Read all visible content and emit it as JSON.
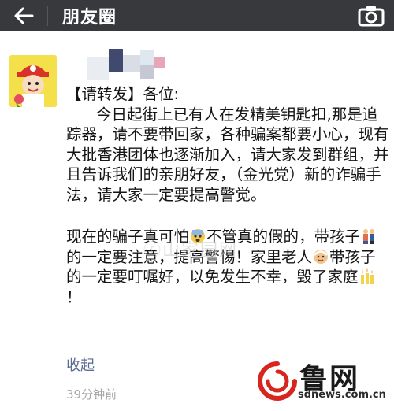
{
  "header": {
    "title": "朋友圈",
    "back_icon": "arrow-left-icon",
    "camera_icon": "camera-icon",
    "background": "#38393d"
  },
  "post": {
    "heading": "【请转发】各位:",
    "para1": "今日起街上已有人在发精美钥匙扣,那是追踪器，请不要带回家，各种骗案都要小心，现有大批香港团体也逐渐加入，请大家发到群组，并且告诉我们的亲朋好友，（金光党）新的诈骗手法，请大家一定要提高警觉。",
    "para2_a": "现在的骗子真可怕",
    "para2_b": "不管真的假的，带孩子",
    "para2_c": "的一定要注意，提高警惕！家里老人",
    "para2_d": "带孩子的一定要叮嘱好，以免发生不幸，毁了家庭",
    "para2_e": "！",
    "collapse_label": "收起",
    "timestamp": "39分钟前"
  },
  "watermark": {
    "center": "ⓡ山家园网",
    "logo_text": "鲁网",
    "logo_url": "sdnews.com.cn"
  }
}
